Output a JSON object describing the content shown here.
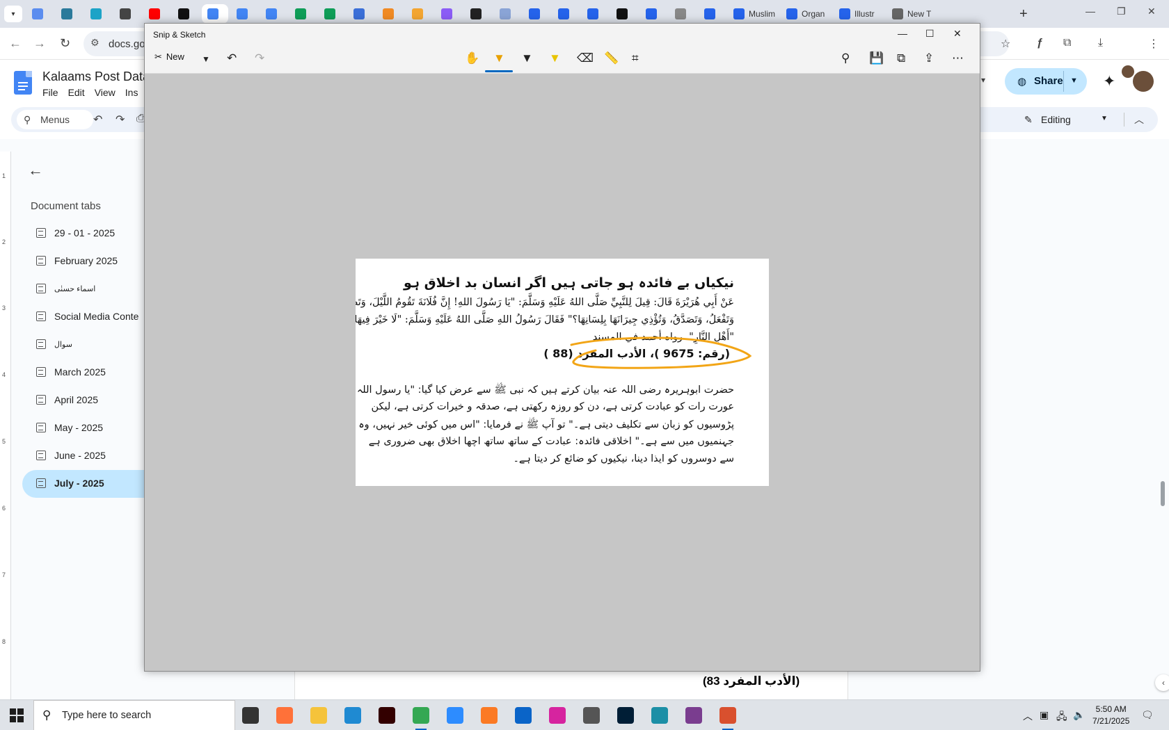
{
  "browser": {
    "tabs": [
      {
        "label": "",
        "color": "#5b8def",
        "active": false
      },
      {
        "label": "",
        "color": "#2b7a9b",
        "active": false
      },
      {
        "label": "",
        "color": "#1ca3c7",
        "active": false
      },
      {
        "label": "",
        "color": "#444444",
        "active": false
      },
      {
        "label": "",
        "color": "#ff0000",
        "active": false
      },
      {
        "label": "",
        "color": "#111111",
        "active": false
      },
      {
        "label": "",
        "color": "#4285f4",
        "active": true
      },
      {
        "label": "",
        "color": "#4285f4",
        "active": false
      },
      {
        "label": "",
        "color": "#4285f4",
        "active": false
      },
      {
        "label": "",
        "color": "#0f9d58",
        "active": false
      },
      {
        "label": "",
        "color": "#0f9d58",
        "active": false
      },
      {
        "label": "",
        "color": "#3b6fd8",
        "active": false
      },
      {
        "label": "",
        "color": "#f08a24",
        "active": false
      },
      {
        "label": "",
        "color": "#f3a531",
        "active": false
      },
      {
        "label": "",
        "color": "#8b5cf6",
        "active": false
      },
      {
        "label": "",
        "color": "#222222",
        "active": false
      },
      {
        "label": "",
        "color": "#8aa4d6",
        "active": false
      },
      {
        "label": "",
        "color": "#2563eb",
        "active": false
      },
      {
        "label": "",
        "color": "#2563eb",
        "active": false
      },
      {
        "label": "",
        "color": "#2563eb",
        "active": false
      },
      {
        "label": "",
        "color": "#111111",
        "active": false
      },
      {
        "label": "",
        "color": "#2563eb",
        "active": false
      },
      {
        "label": "",
        "color": "#888888",
        "active": false
      },
      {
        "label": "",
        "color": "#2563eb",
        "active": false
      },
      {
        "label": "Muslim",
        "color": "#2563eb",
        "active": false
      },
      {
        "label": "Organ",
        "color": "#2563eb",
        "active": false
      },
      {
        "label": "Illustr",
        "color": "#2563eb",
        "active": false
      },
      {
        "label": "New T",
        "color": "#666666",
        "active": false
      }
    ],
    "url": "docs.goo"
  },
  "docs": {
    "title": "Kalaams Post Data",
    "menu": [
      "File",
      "Edit",
      "View",
      "Ins"
    ],
    "share_label": "Share",
    "menus_search": "Menus",
    "editing_label": "Editing",
    "sidebar": {
      "title": "Document tabs",
      "tabs": [
        {
          "label": "29 - 01 - 2025",
          "selected": false
        },
        {
          "label": "February 2025",
          "selected": false
        },
        {
          "label": "اسماء حسنٰی",
          "selected": false
        },
        {
          "label": "Social Media Conte",
          "selected": false
        },
        {
          "label": "سوال",
          "selected": false
        },
        {
          "label": "March 2025",
          "selected": false
        },
        {
          "label": "April 2025",
          "selected": false
        },
        {
          "label": "May - 2025",
          "selected": false
        },
        {
          "label": "June - 2025",
          "selected": false
        },
        {
          "label": "July - 2025",
          "selected": true
        }
      ]
    },
    "ruler_numbers": [
      "1",
      "2",
      "3",
      "4",
      "5",
      "6",
      "7",
      "8"
    ],
    "page_visible_text": "(الأدب المفرد 83)"
  },
  "snip": {
    "title": "Snip & Sketch",
    "new_label": "New",
    "active_tool": "ballpoint-pen",
    "annotation_color": "#f2a516",
    "image": {
      "heading": "نیکیاں بے فائدہ ہو جاتی ہیں اگر انسان بد اخلاق ہو",
      "arabic": [
        "عَنْ أَبِي هُرَيْرَةَ قَالَ: قِيلَ لِلنَّبِيِّ صَلَّى اللهُ عَلَيْهِ وَسَلَّمَ: \"يَا رَسُولَ اللهِ! إِنَّ فُلَانَةَ تَقُومُ اللَّيْلَ، وَتَصُومُ",
        "وَتَفْعَلُ، وَتَصَدَّقُ، وَتُؤْذِي جِيرَانَهَا بِلِسَانِهَا؟\" فَقَالَ رَسُولُ اللهِ صَلَّى اللهُ عَلَيْهِ وَسَلَّمَ: \"لَا خَيْرَ فِيهَا",
        "\"أَهْلِ النَّارِ\". رواه أحمد في المسند"
      ],
      "reference": "(رقم: 9675 )، الأدب المفرد (88 )",
      "urdu": [
        "حضرت ابوہریرہ رضی اللہ عنہ بیان کرتے ہیں کہ نبی ﷺ سے عرض کیا گیا: \"یا رسول اللہ",
        "عورت رات کو عبادت کرتی ہے، دن کو روزہ رکھتی ہے، صدقہ و خیرات کرتی ہے، لیکن",
        "پڑوسیوں کو زبان سے تکلیف دیتی ہے۔\" تو آپ ﷺ نے فرمایا: \"اس میں کوئی خیر نہیں، وہ",
        "جہنمیوں میں سے ہے۔\" اخلاقی فائدہ: عبادت کے ساتھ ساتھ اچھا اخلاق بھی ضروری ہے",
        "سے دوسروں کو ایذا دینا، نیکیوں کو ضائع کر دیتا ہے۔"
      ]
    }
  },
  "taskbar": {
    "search_placeholder": "Type here to search",
    "time": "5:50 AM",
    "date": "7/21/2025",
    "apps": [
      {
        "name": "task-view",
        "color": "#333333",
        "running": false
      },
      {
        "name": "firefox",
        "color": "#ff7139",
        "running": false
      },
      {
        "name": "file-explorer",
        "color": "#f5c33b",
        "running": false
      },
      {
        "name": "vscode",
        "color": "#1f8ad2",
        "running": false
      },
      {
        "name": "illustrator",
        "color": "#330000",
        "running": false
      },
      {
        "name": "chrome",
        "color": "#34a853",
        "running": true
      },
      {
        "name": "zoom",
        "color": "#2d8cff",
        "running": false
      },
      {
        "name": "xampp",
        "color": "#fb7a24",
        "running": false
      },
      {
        "name": "outlook",
        "color": "#0a64c8",
        "running": false
      },
      {
        "name": "instagram",
        "color": "#d6249f",
        "running": false
      },
      {
        "name": "pen-tool",
        "color": "#555555",
        "running": false
      },
      {
        "name": "photoshop",
        "color": "#001e36",
        "running": false
      },
      {
        "name": "app-blue",
        "color": "#1c8fa6",
        "running": false
      },
      {
        "name": "winrar",
        "color": "#7a3d8f",
        "running": false
      },
      {
        "name": "snip-sketch",
        "color": "#d9502e",
        "running": true
      }
    ]
  }
}
